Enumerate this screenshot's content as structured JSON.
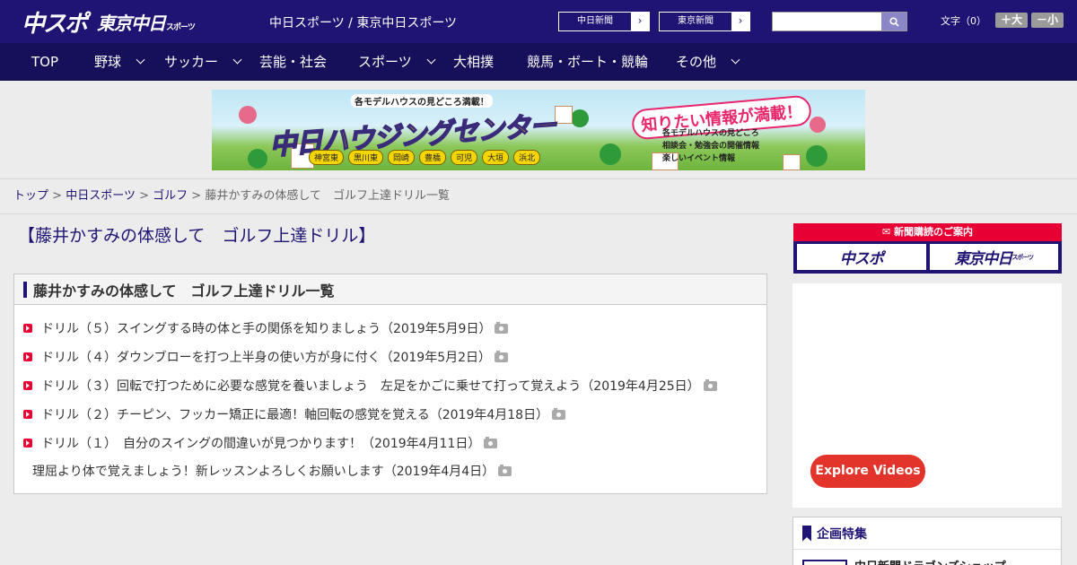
{
  "header": {
    "logo_chuspo": "中スポ",
    "logo_tokyo": "東京中日",
    "logo_tokyo_small": "スポーツ",
    "site_links": "中日スポーツ / 東京中日スポーツ",
    "paper_chunichi": "中日新聞",
    "paper_tokyo": "東京新聞",
    "search": {
      "placeholder": "",
      "value": ""
    },
    "font_label": "文字（0）",
    "font_plus": "＋大",
    "font_minus": "－小",
    "brand_color": "#1f1473"
  },
  "nav": [
    {
      "label": "TOP",
      "has_menu": false
    },
    {
      "label": "野球",
      "has_menu": true
    },
    {
      "label": "サッカー",
      "has_menu": true
    },
    {
      "label": "芸能・社会",
      "has_menu": false
    },
    {
      "label": "スポーツ",
      "has_menu": true
    },
    {
      "label": "大相撲",
      "has_menu": false
    },
    {
      "label": "競馬・ボート・競輪",
      "has_menu": false
    },
    {
      "label": "その他",
      "has_menu": true
    }
  ],
  "banner": {
    "sub": "各モデルハウスの見どころ満載！",
    "main": "中日ハウジングセンター",
    "tag": "知りたい情報が満載！",
    "info1": "各モデルハウスの見どころ",
    "info2": "相談会・勉強会の開催情報",
    "info3": "楽しいイベント情報",
    "towns": [
      "神宮東",
      "黒川東",
      "岡崎",
      "豊橋",
      "可児",
      "大垣",
      "浜北"
    ]
  },
  "breadcrumb": {
    "top": "トップ",
    "section": "中日スポーツ",
    "category": "ゴルフ",
    "current": "藤井かすみの体感して　ゴルフ上達ドリル一覧",
    "separator": ">"
  },
  "main": {
    "title": "【藤井かすみの体感して　ゴルフ上達ドリル】",
    "list_heading": "藤井かすみの体感して　ゴルフ上達ドリル一覧",
    "articles": [
      {
        "text": "ドリル（５）スイングする時の体と手の関係を知りましょう（2019年5月9日）",
        "bullet": true
      },
      {
        "text": "ドリル（４）ダウンブローを打つ上半身の使い方が身に付く（2019年5月2日）",
        "bullet": true
      },
      {
        "text": "ドリル（３）回転で打つために必要な感覚を養いましょう　左足をかごに乗せて打って覚えよう（2019年4月25日）",
        "bullet": true
      },
      {
        "text": "ドリル（２）チーピン、フッカー矯正に最適！軸回転の感覚を覚える（2019年4月18日）",
        "bullet": true
      },
      {
        "text": "ドリル（１）　自分のスイングの間違いが見つかります！（2019年4月11日）",
        "bullet": true
      },
      {
        "text": "理屈より体で覚えましょう！新レッスンよろしくお願いします（2019年4月4日）",
        "bullet": false
      }
    ]
  },
  "sidebar": {
    "subscribe_heading": "新聞購読のご案内",
    "sub_logo1": "中スポ",
    "sub_logo2": "東京中日",
    "sub_logo2_small": "スポーツ",
    "video_button": "Explore Videos",
    "feature_heading": "企画特集",
    "feature_item": "中日新聞ドラゴンズショップ"
  }
}
